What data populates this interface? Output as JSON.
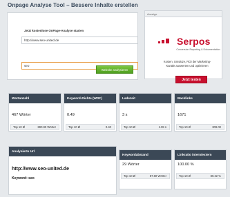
{
  "header": {
    "title": "Onpage Analyse Tool – Bessere Inhalte erstellen"
  },
  "form": {
    "label": "Jetzt kostenlose OnPage-Analyse starten",
    "url_value": "http://www.seo-united.de",
    "keyword_value": "seo",
    "submit_label": "Website analysieren"
  },
  "ad": {
    "header": "Anzeige",
    "brand_name": "Serpos",
    "brand_tagline": "Conversion Reporting & Dokumentation",
    "text_line1": "Kosten, Umsätze, ROI der Marketing-",
    "text_line2": "Kanäle auswerten und optimieren",
    "cta_label": "Jetzt testen",
    "brand_color": "#c8102e"
  },
  "metrics": [
    {
      "title": "Wortanzahl",
      "value": "467 Wörter",
      "top10_label": "Top 10 Ø",
      "top10_value": "890.90 Wörter"
    },
    {
      "title": "Keyword-Dichte (WDF)",
      "value": "0.49",
      "top10_label": "Top 10 Ø",
      "top10_value": "0.40"
    },
    {
      "title": "Ladezeit",
      "value": "3 s",
      "top10_label": "Top 10 Ø",
      "top10_value": "1.99 s"
    },
    {
      "title": "Backlinks",
      "value": "1671",
      "top10_label": "Top 10 Ø",
      "top10_value": "309.00"
    }
  ],
  "analyzed": {
    "title": "Analysierte Url",
    "url": "http://www.seo-united.de",
    "keyword_line": "Keyword: seo"
  },
  "keyword_distance": {
    "title": "Keywordabstand",
    "value": "29 Wörter",
    "top10_label": "Top 10 Ø",
    "top10_value": "87.60 Wörter"
  },
  "link_ratio": {
    "title": "Linkratio intern/extern",
    "value": "100.00 %",
    "top10_label": "Top 10 Ø",
    "top10_value": "89.22 %"
  }
}
